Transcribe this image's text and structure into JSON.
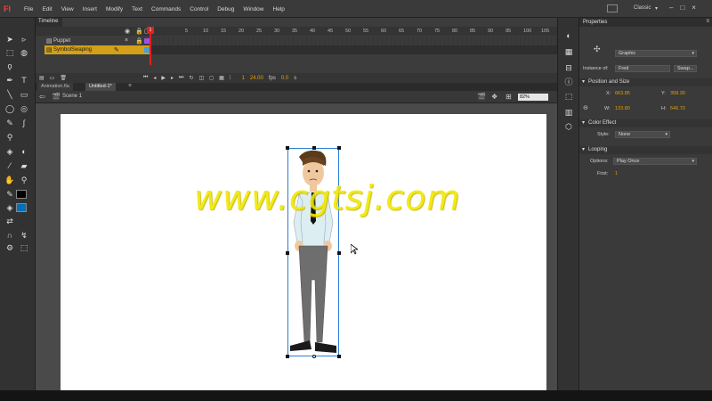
{
  "app": {
    "logo": "Fl"
  },
  "menu": [
    "File",
    "Edit",
    "View",
    "Insert",
    "Modify",
    "Text",
    "Commands",
    "Control",
    "Debug",
    "Window",
    "Help"
  ],
  "workspace": {
    "name": "Classic"
  },
  "timeline": {
    "tab_label": "Timeline",
    "frame_numbers": [
      "5",
      "10",
      "15",
      "20",
      "25",
      "30",
      "35",
      "40",
      "45",
      "50",
      "55",
      "60",
      "65",
      "70",
      "75",
      "80",
      "85",
      "90",
      "95",
      "100",
      "105"
    ],
    "playhead_frame": "1",
    "layers": [
      {
        "name": "Puppet"
      },
      {
        "name": "SymbolSwaping"
      }
    ],
    "controls": {
      "frame": "1",
      "fps": "24.00",
      "fps_unit": "fps",
      "time": "0.0",
      "time_unit": "s"
    }
  },
  "documents": {
    "tabs": [
      "Animation.fla",
      "Untitled-1*"
    ]
  },
  "edit_bar": {
    "scene": "Scene 1",
    "zoom": "82%"
  },
  "watermark": "www.cgtsj.com",
  "properties": {
    "tab_label": "Properties",
    "symbol_type": "Graphic",
    "instance_of_label": "Instance of:",
    "instance_of_value": "Fred",
    "swap_label": "Swap...",
    "position_size": {
      "heading": "Position and Size",
      "x_label": "X:",
      "x": "663.85",
      "y_label": "Y:",
      "y": "358.30",
      "w_label": "W:",
      "w": "133.80",
      "h_label": "H:",
      "h": "546.70"
    },
    "color_effect": {
      "heading": "Color Effect",
      "style_label": "Style:",
      "style_value": "None"
    },
    "looping": {
      "heading": "Looping",
      "options_label": "Options:",
      "options_value": "Play Once",
      "first_label": "First:",
      "first_value": "1"
    }
  }
}
